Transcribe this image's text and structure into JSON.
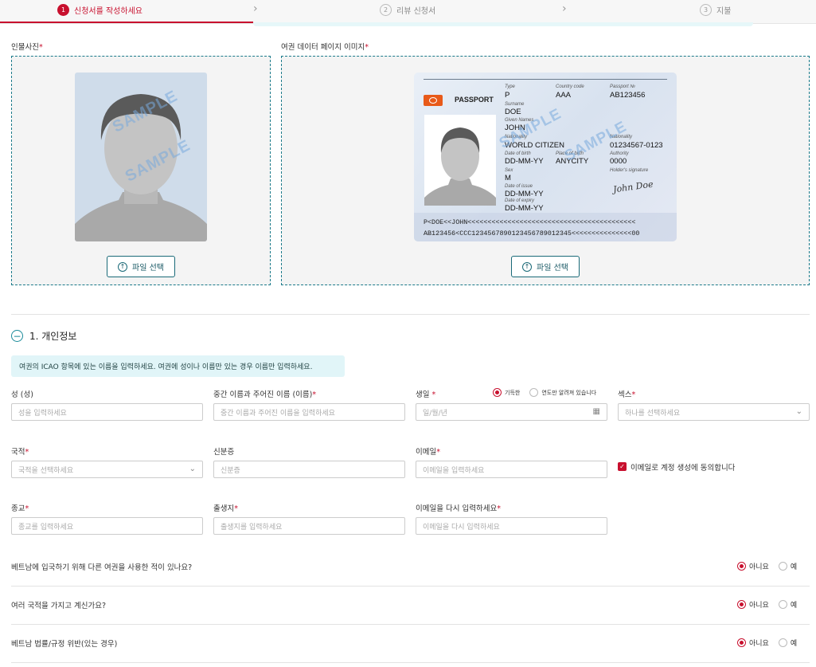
{
  "stepper": {
    "steps": [
      {
        "num": "1",
        "label": "신청서를 작성하세요"
      },
      {
        "num": "2",
        "label": "리뷰 신청서"
      },
      {
        "num": "3",
        "label": "지불"
      }
    ]
  },
  "uploads": {
    "portrait": {
      "label": "인물사진",
      "button": "파일 선택",
      "watermark": "SAMPLE"
    },
    "passport": {
      "label": "여권 데이터 페이지 이미지",
      "button": "파일 선택",
      "watermark": "SAMPLE",
      "sample": {
        "title": "PASSPORT",
        "type_label": "Type",
        "type": "P",
        "country_label": "Country code",
        "country": "AAA",
        "passport_no_label": "Passport №",
        "passport_no": "AB123456",
        "surname_label": "Surname",
        "surname": "DOE",
        "given_label": "Given Names",
        "given": "JOHN",
        "nationality_label": "Nationality",
        "nationality": "WORLD CITIZEN",
        "personal_no_label": "Nationality",
        "personal_no": "01234567-0123",
        "dob_label": "Date of birth",
        "dob": "DD-MM-YY",
        "pob_label": "Place of birth",
        "pob": "ANYCITY",
        "authority_label": "Authority",
        "authority": "0000",
        "sex_label": "Sex",
        "sex": "M",
        "signature_label": "Holder's signature",
        "signature": "John Doe",
        "issue_label": "Date of issue",
        "issue": "DD-MM-YY",
        "expiry_label": "Date of expiry",
        "expiry": "DD-MM-YY",
        "mrz1": "P<DOE<<JOHN<<<<<<<<<<<<<<<<<<<<<<<<<<<<<<<<<<<<<<<<<<",
        "mrz2": "AB123456<CCC1234567890123456789012345<<<<<<<<<<<<<<<00"
      }
    }
  },
  "personal": {
    "section_title": "1. 개인정보",
    "note": "여권의 ICAO 항목에 있는 이름을 입력하세요. 여권에 성이나 이름만 있는 경우 이름만 입력하세요.",
    "surname": {
      "label": "성 (성)",
      "placeholder": "성을 입력하세요"
    },
    "middle": {
      "label": "중간 이름과 주어진 이름 (이름)",
      "placeholder": "중간 이름과 주어진 이름을 입력하세요"
    },
    "dob": {
      "label": "생일",
      "placeholder": "일/월/년",
      "opt_full": "기득한",
      "opt_year": "연도만 알려져 있습니다"
    },
    "sex": {
      "label": "섹스",
      "placeholder": "하나를 선택하세요"
    },
    "nationality": {
      "label": "국적",
      "placeholder": "국적을 선택하세요"
    },
    "id_no": {
      "label": "신분증",
      "placeholder": "신분증"
    },
    "email": {
      "label": "이메일",
      "placeholder": "이메일을 입력하세요"
    },
    "consent": "이메일로 계정 생성에 동의합니다",
    "religion": {
      "label": "종교",
      "placeholder": "종교를 입력하세요"
    },
    "birthplace": {
      "label": "출생지",
      "placeholder": "출생지를 입력하세요"
    },
    "email_confirm": {
      "label": "이메일을 다시 입력하세요",
      "placeholder": "이메일을 다시 입력하세요"
    }
  },
  "questions": [
    {
      "text": "베트남에 입국하기 위해 다른 여권을 사용한 적이 있나요?",
      "no": "아니요",
      "yes": "예"
    },
    {
      "text": "여러 국적을 가지고 계신가요?",
      "no": "아니요",
      "yes": "예"
    },
    {
      "text": "베트남 법률/규정 위반(있는 경우)",
      "no": "아니요",
      "yes": "예"
    }
  ],
  "colors": {
    "accent_red": "#c8102e",
    "accent_teal": "#1a7a8a",
    "note_bg": "#e1f5f8"
  }
}
